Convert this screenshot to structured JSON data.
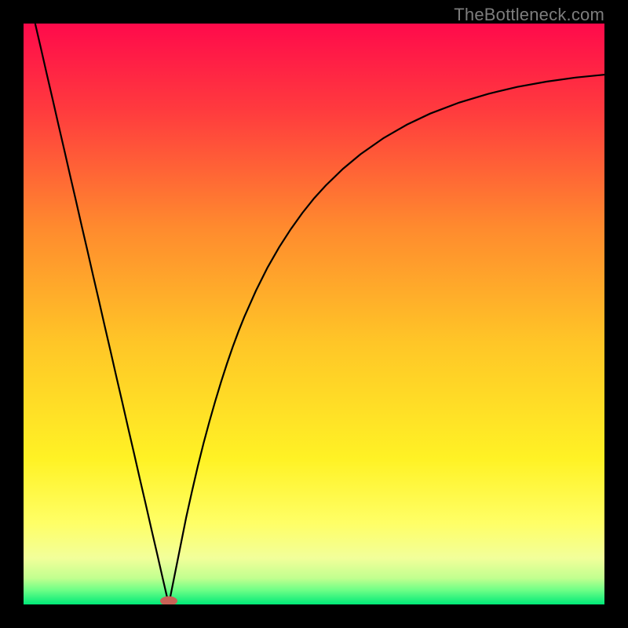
{
  "watermark": "TheBottleneck.com",
  "chart_data": {
    "type": "line",
    "title": "",
    "xlabel": "",
    "ylabel": "",
    "xlim": [
      0,
      100
    ],
    "ylim": [
      0,
      100
    ],
    "grid": false,
    "background_gradient": {
      "stops": [
        {
          "pct": 0.0,
          "color": "#ff0a4b"
        },
        {
          "pct": 0.15,
          "color": "#ff3b3e"
        },
        {
          "pct": 0.35,
          "color": "#ff8a2e"
        },
        {
          "pct": 0.55,
          "color": "#ffc627"
        },
        {
          "pct": 0.75,
          "color": "#fff225"
        },
        {
          "pct": 0.86,
          "color": "#ffff66"
        },
        {
          "pct": 0.92,
          "color": "#f2ff9a"
        },
        {
          "pct": 0.955,
          "color": "#c1ff8f"
        },
        {
          "pct": 0.975,
          "color": "#6fff87"
        },
        {
          "pct": 1.0,
          "color": "#00e978"
        }
      ]
    },
    "marker": {
      "x": 25,
      "y": 0.6,
      "color": "#c96257"
    },
    "series": [
      {
        "name": "curve",
        "color": "#000000",
        "x": [
          2,
          3,
          4,
          5,
          6,
          7,
          8,
          9,
          10,
          11,
          12,
          13,
          14,
          15,
          16,
          17,
          18,
          19,
          20,
          21,
          22,
          23,
          24,
          25,
          26,
          27,
          28,
          29,
          30,
          31,
          32,
          33,
          34,
          35,
          36,
          37,
          38,
          40,
          42,
          44,
          46,
          48,
          50,
          52,
          55,
          58,
          62,
          66,
          70,
          75,
          80,
          85,
          90,
          95,
          100
        ],
        "y": [
          100,
          95.7,
          91.3,
          87.0,
          82.6,
          78.3,
          73.9,
          69.6,
          65.2,
          60.9,
          56.5,
          52.2,
          47.8,
          43.5,
          39.1,
          34.8,
          30.4,
          26.1,
          21.7,
          17.4,
          13.0,
          8.7,
          4.3,
          0.0,
          5.0,
          10.0,
          15.0,
          19.5,
          23.8,
          27.8,
          31.5,
          35.0,
          38.3,
          41.4,
          44.3,
          47.0,
          49.5,
          54.0,
          58.0,
          61.5,
          64.6,
          67.4,
          69.9,
          72.1,
          75.0,
          77.5,
          80.3,
          82.6,
          84.5,
          86.4,
          87.9,
          89.1,
          90.0,
          90.7,
          91.2
        ]
      }
    ]
  }
}
